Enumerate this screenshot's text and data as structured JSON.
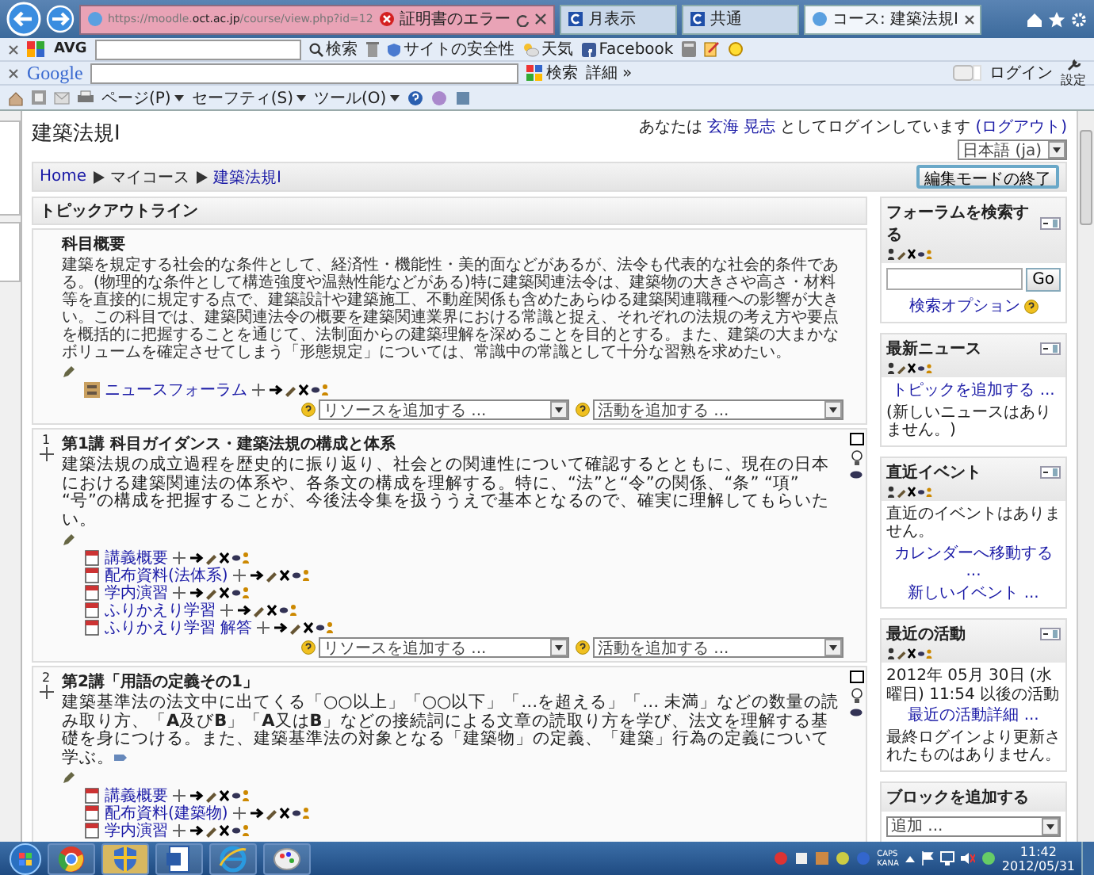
{
  "browser": {
    "address": "https://moodle.**oct.ac.jp**/course/view.php?id=12",
    "cert_error": "証明書のエラー",
    "tabs": [
      {
        "label": "月表示",
        "selected": false
      },
      {
        "label": "共通",
        "selected": false
      },
      {
        "label": "コース: 建築法規Ⅰ",
        "selected": true
      }
    ]
  },
  "avg_toolbar": {
    "brand": "AVG",
    "search_button": "検索",
    "safety": "サイトの安全性",
    "weather": "天気",
    "facebook": "Facebook"
  },
  "google_toolbar": {
    "brand": "Google",
    "search_button": "検索",
    "more": "詳細 »",
    "login": "ログイン",
    "settings": "設定"
  },
  "command_bar": {
    "menus": [
      "ページ(P)",
      "セーフティ(S)",
      "ツール(O)"
    ]
  },
  "page": {
    "title": "建築法規Ⅰ",
    "login_info": {
      "prefix": "あなたは",
      "user": "玄海 晃志",
      "suffix": "としてログインしています",
      "logout": "(ログアウト)"
    },
    "language": "日本語 (ja)",
    "breadcrumb": [
      {
        "label": "Home",
        "link": true
      },
      {
        "label": "マイコース",
        "link": false
      },
      {
        "label": "建築法規Ⅰ",
        "link": true
      }
    ],
    "edit_button": "編集モードの終了",
    "outline_title": "トピックアウトライン",
    "sections": [
      {
        "title": "科目概要",
        "summary": "建築を規定する社会的な条件として、経済性・機能性・美的面などがあるが、法令も代表的な社会的条件である。(物理的な条件として構造強度や温熱性能などがある)特に建築関連法令は、建築物の大きさや高さ・材料等を直接的に規定する点で、建築設計や建築施工、不動産関係も含めたあらゆる建築関連職種への影響が大きい。この科目では、建築関連法令の概要を建築関連業界における常識と捉え、それぞれの法規の考え方や要点を概括的に把握することを通じて、法制面からの建築理解を深めることを目的とする。また、建築の大まかなボリュームを確定させてしまう「形態規定」については、常識中の常識として十分な習熟を求めたい。",
        "large": false,
        "items": [
          {
            "label": "ニュースフォーラム",
            "kind": "forum"
          }
        ],
        "add_resource": "リソースを追加する ...",
        "add_activity": "活動を追加する ..."
      },
      {
        "number": "1",
        "title": "第1講 科目ガイダンス・建築法規の構成と体系",
        "summary": "建築法規の成立過程を歴史的に振り返り、社会との関連性について確認するとともに、現在の日本における建築関連法の体系や、各条文の構成を理解する。特に、“法”と“令”の関係、“条” “項” “号”の構成を把握することが、今後法令集を扱ううえで基本となるので、確実に理解してもらいたい。",
        "large": true,
        "items": [
          {
            "label": "講義概要",
            "kind": "resource"
          },
          {
            "label": "配布資料(法体系)",
            "kind": "resource"
          },
          {
            "label": "学内演習",
            "kind": "resource"
          },
          {
            "label": "ふりかえり学習",
            "kind": "resource"
          },
          {
            "label": "ふりかえり学習 解答",
            "kind": "resource"
          }
        ],
        "add_resource": "リソースを追加する ...",
        "add_activity": "活動を追加する ..."
      },
      {
        "number": "2",
        "title": "第2講「用語の定義その1」",
        "summary": "建築基準法の法文中に出てくる「○○以上」「○○以下」「…を超える」「… 未満」などの数量の読み取り方、「**A**及び**B**」「**A**又は**B**」などの接続詞による文章の読取り方を学び、法文を理解する基礎を身につける。また、建築基準法の対象となる「建築物」の定義、「建築」行為の定義について学ぶ。",
        "large": true,
        "items": [
          {
            "label": "講義概要",
            "kind": "resource"
          },
          {
            "label": "配布資料(建築物)",
            "kind": "resource"
          },
          {
            "label": "学内演習",
            "kind": "resource"
          }
        ]
      }
    ],
    "blocks": [
      {
        "kind": "search",
        "title": "フォーラムを検索する",
        "button": "Go",
        "link": "検索オプション"
      },
      {
        "kind": "text",
        "title": "最新ニュース",
        "lines": [
          {
            "text": "トピックを追加する ...",
            "link": true
          },
          {
            "text": "(新しいニュースはありません。)",
            "link": false
          }
        ]
      },
      {
        "kind": "text",
        "title": "直近イベント",
        "lines": [
          {
            "text": "直近のイベントはありません。",
            "link": false
          },
          {
            "text": "カレンダーへ移動する ...",
            "link": true
          },
          {
            "text": "新しいイベント ...",
            "link": true
          }
        ]
      },
      {
        "kind": "text",
        "title": "最近の活動",
        "lines": [
          {
            "text": "2012年 05月 30日 (水曜日) 11:54 以後の活動",
            "link": false
          },
          {
            "text": "最近の活動詳細 ...",
            "link": true
          },
          {
            "text": "最終ログインより更新されたものはありません。",
            "link": false
          }
        ]
      },
      {
        "kind": "add",
        "title": "ブロックを追加する",
        "select": "追加 ..."
      }
    ]
  },
  "taskbar": {
    "ime": [
      "CAPS",
      "KANA"
    ],
    "time": "11:42",
    "date": "2012/05/31"
  }
}
